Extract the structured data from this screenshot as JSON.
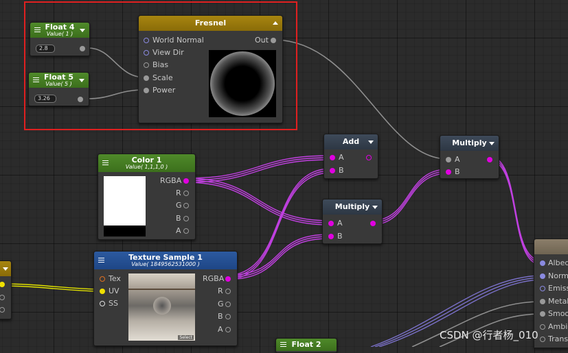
{
  "nodes": {
    "float4": {
      "title": "Float 4",
      "subtitle": "Value( 1 )",
      "value": "2.8"
    },
    "float5": {
      "title": "Float 5",
      "subtitle": "Value( 5 )",
      "value": "3.26"
    },
    "fresnel": {
      "title": "Fresnel",
      "inputs": [
        "World Normal",
        "View Dir",
        "Bias",
        "Scale",
        "Power"
      ],
      "output": "Out"
    },
    "color1": {
      "title": "Color 1",
      "subtitle": "Value( 1,1,1,0 )",
      "outputs": [
        "RGBA",
        "R",
        "G",
        "B",
        "A"
      ]
    },
    "texture": {
      "title": "Texture Sample 1",
      "subtitle": "Value( 1849562531000 )",
      "inputs": [
        "Tex",
        "UV",
        "SS"
      ],
      "outputs": [
        "RGBA",
        "R",
        "G",
        "B",
        "A"
      ],
      "select_label": "Select"
    },
    "add": {
      "title": "Add",
      "inputs": [
        "A",
        "B"
      ]
    },
    "multiply_mid": {
      "title": "Multiply",
      "inputs": [
        "A",
        "B"
      ]
    },
    "multiply_right": {
      "title": "Multiply",
      "inputs": [
        "A",
        "B"
      ]
    },
    "master": {
      "inputs": [
        "Albed",
        "Norm",
        "Emiss",
        "Metal",
        "Smoo",
        "Ambie",
        "Trans"
      ]
    },
    "float2": {
      "title": "Float 2"
    }
  },
  "watermark": "CSDN @行者杨_010",
  "colors": {
    "highlight": "#e02020",
    "header_green": "#4f8a2a",
    "header_gold": "#a78510",
    "header_blue": "#2c5aa0",
    "wire_magenta": "#c040e0",
    "wire_grey": "#9a9a9a",
    "wire_yellow": "#e0e000"
  }
}
